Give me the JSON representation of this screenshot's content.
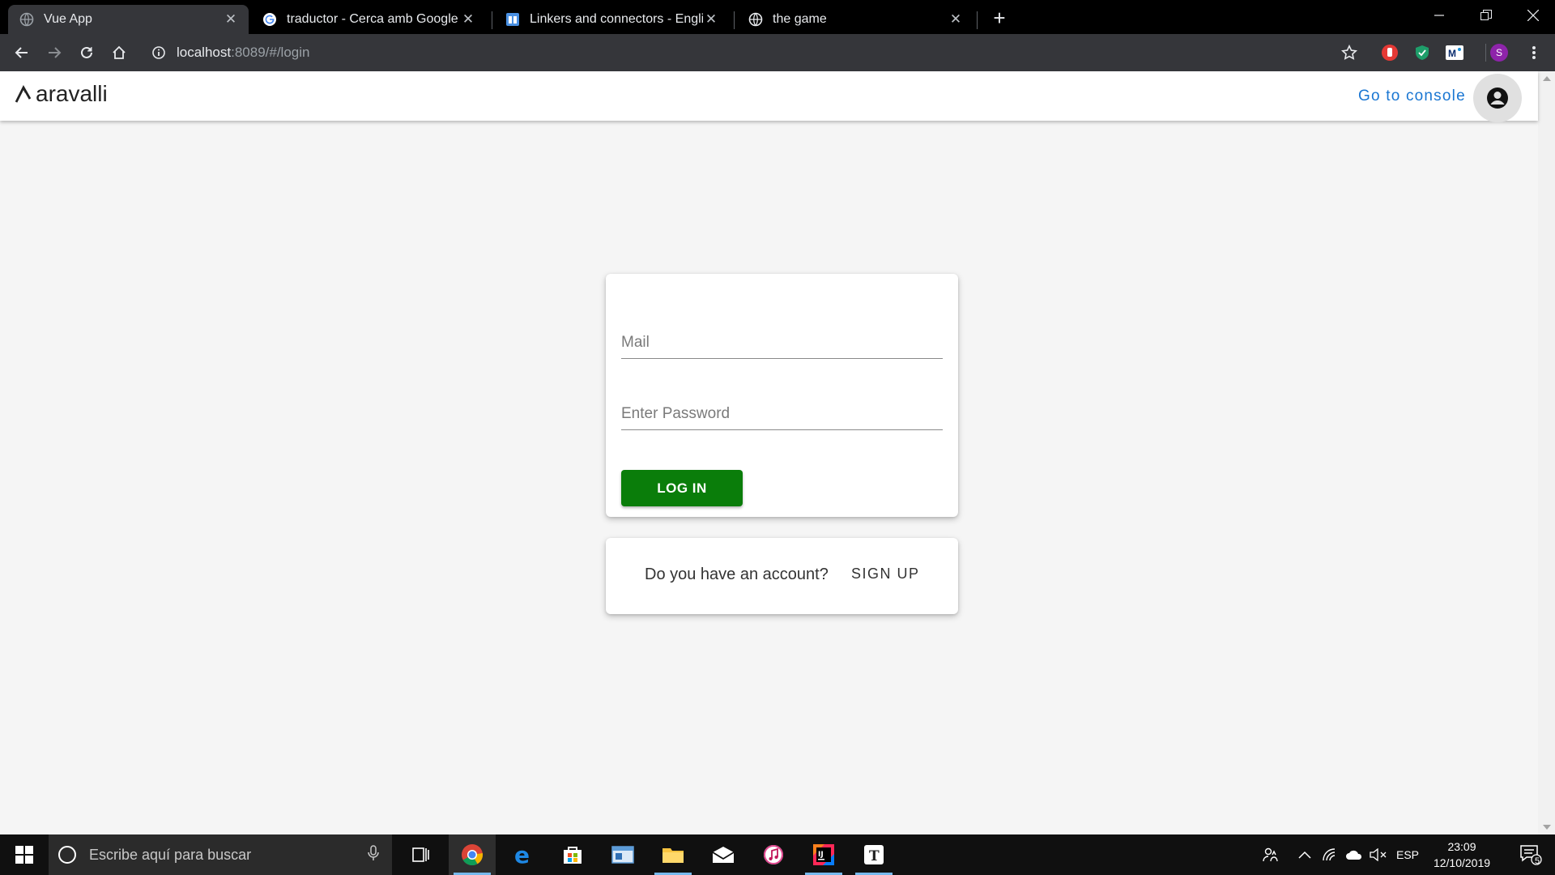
{
  "browser": {
    "tabs": [
      {
        "title": "Vue App",
        "active": true
      },
      {
        "title": "traductor - Cerca amb Google",
        "active": false
      },
      {
        "title": "Linkers and connectors - English",
        "active": false
      },
      {
        "title": "the game",
        "active": false
      }
    ],
    "url_host": "localhost",
    "url_path": ":8089/#/login",
    "profile_initial": "S"
  },
  "app": {
    "brand": "aravalli",
    "go_to_console": "Go to console"
  },
  "login": {
    "mail_placeholder": "Mail",
    "password_placeholder": "Enter Password",
    "login_button": "LOG IN"
  },
  "signup": {
    "question": "Do you have an account?",
    "button": "SIGN UP"
  },
  "taskbar": {
    "search_placeholder": "Escribe aquí para buscar",
    "language": "ESP",
    "time": "23:09",
    "date": "12/10/2019",
    "notification_count": "5"
  },
  "colors": {
    "accent_link": "#1976d2",
    "login_button": "#0a7d0a",
    "page_background": "#f5f5f5"
  }
}
